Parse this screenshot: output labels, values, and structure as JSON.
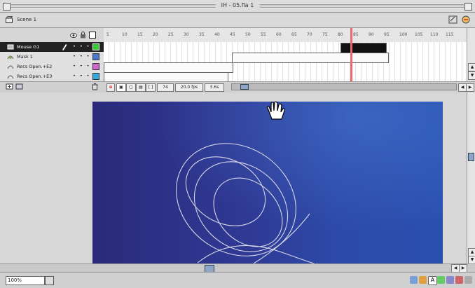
{
  "window": {
    "title": "IH - 05.fla 1"
  },
  "scene": {
    "label": "Scene 1"
  },
  "timeline": {
    "layers": [
      {
        "name": "Mouse G1",
        "selected": true
      },
      {
        "name": "Mask 1",
        "selected": false
      },
      {
        "name": "Recs Open.+E2",
        "selected": false
      },
      {
        "name": "Recs Open.+E3",
        "selected": false
      }
    ],
    "ruler_ticks": [
      "5",
      "10",
      "15",
      "20",
      "25",
      "30",
      "35",
      "40",
      "45",
      "50",
      "55",
      "60",
      "65",
      "70",
      "75",
      "80",
      "85",
      "90",
      "95",
      "100",
      "105",
      "110",
      "115"
    ],
    "bottom": {
      "frame": "74",
      "fps": "20.0 fps",
      "time": "3.6s"
    }
  },
  "statusbar": {
    "zoom": "100%"
  },
  "colors": {
    "stage_left": "#2b2a7a",
    "stage_right": "#2a50b0",
    "playhead": "#ee6a6a",
    "selection": "#222222"
  }
}
